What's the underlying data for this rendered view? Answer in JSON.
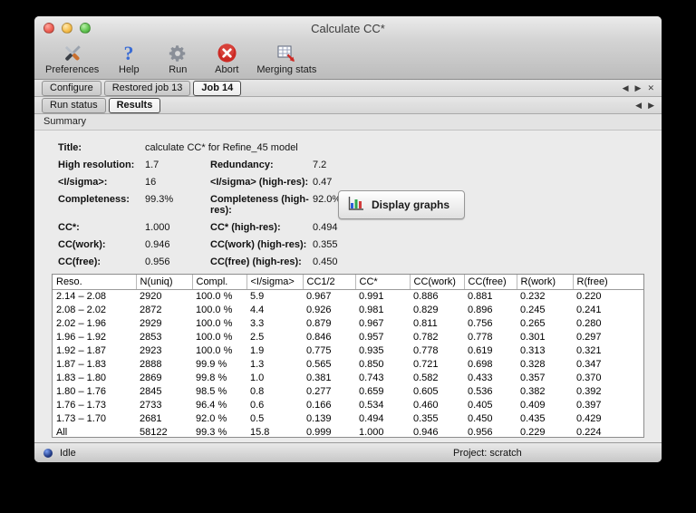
{
  "window": {
    "title": "Calculate CC*"
  },
  "toolbar": {
    "items": [
      {
        "label": "Preferences",
        "icon": "tools-icon"
      },
      {
        "label": "Help",
        "icon": "question-mark-icon"
      },
      {
        "label": "Run",
        "icon": "gear-icon"
      },
      {
        "label": "Abort",
        "icon": "abort-x-icon"
      },
      {
        "label": "Merging stats",
        "icon": "merging-stats-table-icon"
      }
    ]
  },
  "tabs": {
    "main": [
      {
        "label": "Configure"
      },
      {
        "label": "Restored job 13"
      },
      {
        "label": "Job 14"
      }
    ],
    "active_main": "Job 14",
    "sub": [
      {
        "label": "Run status"
      },
      {
        "label": "Results"
      }
    ],
    "active_sub": "Results",
    "nav": {
      "back": "◀",
      "forward": "▶",
      "close": "✕"
    }
  },
  "summary": {
    "section_label": "Summary",
    "title_label": "Title:",
    "title_value": "calculate CC* for Refine_45 model",
    "rows": [
      {
        "l1": "High resolution:",
        "v1": "1.7",
        "l2": "Redundancy:",
        "v2": "7.2"
      },
      {
        "l1": "<I/sigma>:",
        "v1": "16",
        "l2": "<I/sigma> (high-res):",
        "v2": "0.47"
      },
      {
        "l1": "Completeness:",
        "v1": "99.3%",
        "l2": "Completeness (high-res):",
        "v2": "92.0%"
      },
      {
        "l1": "CC*:",
        "v1": "1.000",
        "l2": "CC* (high-res):",
        "v2": "0.494"
      },
      {
        "l1": "CC(work):",
        "v1": "0.946",
        "l2": "CC(work) (high-res):",
        "v2": "0.355"
      },
      {
        "l1": "CC(free):",
        "v1": "0.956",
        "l2": "CC(free) (high-res):",
        "v2": "0.450"
      }
    ],
    "display_graphs_label": "Display graphs"
  },
  "table": {
    "columns": [
      "Reso.",
      "N(uniq)",
      "Compl.",
      "<I/sigma>",
      "CC1/2",
      "CC*",
      "CC(work)",
      "CC(free)",
      "R(work)",
      "R(free)"
    ],
    "rows": [
      {
        "reso": "2.14 – 2.08",
        "nuniq": "2920",
        "compl": "100.0 %",
        "isigma": "5.9",
        "cc12": "0.967",
        "ccstar": "0.991",
        "ccwork": "0.886",
        "ccfree": "0.881",
        "rwork": "0.232",
        "rfree": "0.220"
      },
      {
        "reso": "2.08 – 2.02",
        "nuniq": "2872",
        "compl": "100.0 %",
        "isigma": "4.4",
        "cc12": "0.926",
        "ccstar": "0.981",
        "ccwork": "0.829",
        "ccfree": "0.896",
        "rwork": "0.245",
        "rfree": "0.241"
      },
      {
        "reso": "2.02 – 1.96",
        "nuniq": "2929",
        "compl": "100.0 %",
        "isigma": "3.3",
        "cc12": "0.879",
        "ccstar": "0.967",
        "ccwork": "0.811",
        "ccfree": "0.756",
        "rwork": "0.265",
        "rfree": "0.280"
      },
      {
        "reso": "1.96 – 1.92",
        "nuniq": "2853",
        "compl": "100.0 %",
        "isigma": "2.5",
        "cc12": "0.846",
        "ccstar": "0.957",
        "ccwork": "0.782",
        "ccfree": "0.778",
        "rwork": "0.301",
        "rfree": "0.297"
      },
      {
        "reso": "1.92 – 1.87",
        "nuniq": "2923",
        "compl": "100.0 %",
        "isigma": "1.9",
        "cc12": "0.775",
        "ccstar": "0.935",
        "ccwork": "0.778",
        "ccfree": "0.619",
        "rwork": "0.313",
        "rfree": "0.321"
      },
      {
        "reso": "1.87 – 1.83",
        "nuniq": "2888",
        "compl": "99.9 %",
        "isigma": "1.3",
        "cc12": "0.565",
        "ccstar": "0.850",
        "ccwork": "0.721",
        "ccfree": "0.698",
        "rwork": "0.328",
        "rfree": "0.347"
      },
      {
        "reso": "1.83 – 1.80",
        "nuniq": "2869",
        "compl": "99.8 %",
        "isigma": "1.0",
        "cc12": "0.381",
        "ccstar": "0.743",
        "ccwork": "0.582",
        "ccfree": "0.433",
        "rwork": "0.357",
        "rfree": "0.370"
      },
      {
        "reso": "1.80 – 1.76",
        "nuniq": "2845",
        "compl": "98.5 %",
        "isigma": "0.8",
        "cc12": "0.277",
        "ccstar": "0.659",
        "ccwork": "0.605",
        "ccfree": "0.536",
        "rwork": "0.382",
        "rfree": "0.392"
      },
      {
        "reso": "1.76 – 1.73",
        "nuniq": "2733",
        "compl": "96.4 %",
        "isigma": "0.6",
        "cc12": "0.166",
        "ccstar": "0.534",
        "ccwork": "0.460",
        "ccfree": "0.405",
        "rwork": "0.409",
        "rfree": "0.397"
      },
      {
        "reso": "1.73 – 1.70",
        "nuniq": "2681",
        "compl": "92.0 %",
        "isigma": "0.5",
        "cc12": "0.139",
        "ccstar": "0.494",
        "ccwork": "0.355",
        "ccfree": "0.450",
        "rwork": "0.435",
        "rfree": "0.429"
      },
      {
        "reso": "All",
        "nuniq": "58122",
        "compl": "99.3 %",
        "isigma": "15.8",
        "cc12": "0.999",
        "ccstar": "1.000",
        "ccwork": "0.946",
        "ccfree": "0.956",
        "rwork": "0.229",
        "rfree": "0.224"
      }
    ]
  },
  "statusbar": {
    "status": "Idle",
    "project": "Project: scratch"
  },
  "colors": {
    "status_led_blue": "#27408b",
    "abort_red": "#cc2a24",
    "help_blue": "#3a6cd4",
    "graph_bar_blue": "#2b5fd9",
    "graph_bar_green": "#2fa84f",
    "graph_bar_red": "#d23b3b"
  }
}
